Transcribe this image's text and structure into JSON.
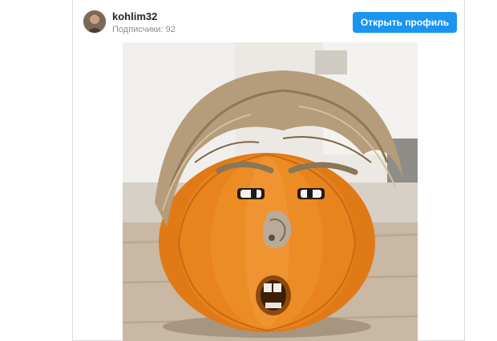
{
  "profile": {
    "username": "kohlim32",
    "followers_label": "Подписчики: 92",
    "open_profile_label": "Открыть профиль"
  },
  "post": {
    "image_icon": "pumpkin-photo"
  },
  "colors": {
    "button": "#1a95f0",
    "pumpkin": "#e8801c",
    "hair": "#b49b78"
  }
}
